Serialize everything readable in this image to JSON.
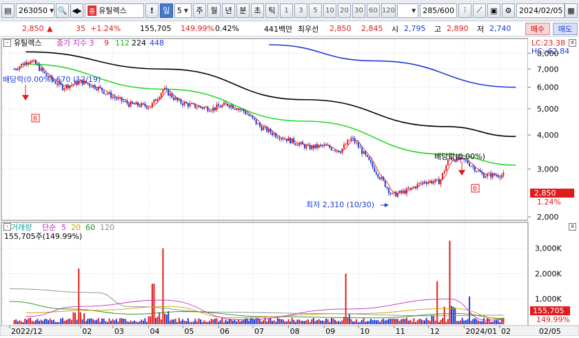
{
  "toolbar": {
    "code": "263050",
    "stock_name": "유틸렉스",
    "badge": "종",
    "period_selected": "일",
    "period_value": "5",
    "periods": [
      "주",
      "월",
      "년",
      "분",
      "초",
      "틱"
    ],
    "numbers": [
      "1",
      "3",
      "5",
      "10",
      "20",
      "30",
      "60",
      "120"
    ],
    "count": "285/600",
    "date": "2024/02/05",
    "alert": "!"
  },
  "quote": {
    "price": "2,850",
    "change": "35",
    "change_pct": "+1.24%",
    "volume": "155,705",
    "volume_ratio": "149.99%",
    "turnover": "0.42%",
    "amount": "441백만",
    "best_sell_label": "최우선",
    "best_sell": "2,850",
    "best_buy": "2,845",
    "open_label": "시",
    "open": "2,795",
    "high_label": "고",
    "high": "2,890",
    "low_label": "저",
    "low": "2,740",
    "buy_label": "매수",
    "sell_label": "매도"
  },
  "price_panel": {
    "title": "유틸렉스",
    "indicator_label": "종가 지수 3",
    "ma_values": [
      "9",
      "112",
      "224",
      "448"
    ],
    "lc_label": "LC:23.38",
    "hc_label": "HC:-62.84",
    "y_ticks": [
      "8,000",
      "7,000",
      "6,000",
      "5,000",
      "4,000",
      "3,000",
      "2,000"
    ],
    "current_price": "2,850",
    "current_pct": "1.24%",
    "high_annotation": "배당락(0.00%) 670 (12/19)",
    "dividend_annotation": "배당락(0.00%)",
    "low_annotation": "최저 2,310 (10/30)",
    "marker_b": "B"
  },
  "volume_panel": {
    "title": "거래량",
    "ma_label": "단순",
    "ma_values": [
      "5",
      "20",
      "60",
      "120"
    ],
    "volume_text": "155,705주(149.99%)",
    "y_ticks": [
      "3,000K",
      "2,000K",
      "1,000K"
    ],
    "current_volume": "155,705",
    "current_pct": "149.99%"
  },
  "x_axis": {
    "labels": [
      "2022/12",
      "02",
      "03",
      "04",
      "05",
      "06",
      "07",
      "08",
      "09",
      "10",
      "11",
      "12",
      "2024/01",
      "02",
      "02/05"
    ]
  },
  "colors": {
    "up": "#e11b1b",
    "down": "#1a3bd6",
    "ma9": "#e11b1b",
    "ma112": "#29d829",
    "ma224": "#000000",
    "ma448": "#1a3bd6"
  },
  "chart_data": {
    "type": "candlestick",
    "title": "유틸렉스",
    "x_range": [
      "2022/12",
      "2024/02/05"
    ],
    "y_range": [
      2000,
      8600
    ],
    "close_series": [
      [
        "2022/12/05",
        7000
      ],
      [
        "2022/12/19",
        7600
      ],
      [
        "2023/01/02",
        6600
      ],
      [
        "2023/01/16",
        6000
      ],
      [
        "2023/02/01",
        6300
      ],
      [
        "2023/02/15",
        6000
      ],
      [
        "2023/03/02",
        5500
      ],
      [
        "2023/03/15",
        5200
      ],
      [
        "2023/04/03",
        5100
      ],
      [
        "2023/04/14",
        5900
      ],
      [
        "2023/04/27",
        5300
      ],
      [
        "2023/05/12",
        5100
      ],
      [
        "2023/05/26",
        5000
      ],
      [
        "2023/06/09",
        5200
      ],
      [
        "2023/06/23",
        4900
      ],
      [
        "2023/07/07",
        4300
      ],
      [
        "2023/07/21",
        4000
      ],
      [
        "2023/08/04",
        3800
      ],
      [
        "2023/08/18",
        3600
      ],
      [
        "2023/09/01",
        3650
      ],
      [
        "2023/09/15",
        3500
      ],
      [
        "2023/09/25",
        3900
      ],
      [
        "2023/10/12",
        3100
      ],
      [
        "2023/10/30",
        2400
      ],
      [
        "2023/11/13",
        2500
      ],
      [
        "2023/11/27",
        2700
      ],
      [
        "2023/12/11",
        2700
      ],
      [
        "2023/12/19",
        3300
      ],
      [
        "2024/01/03",
        3200
      ],
      [
        "2024/01/17",
        2850
      ],
      [
        "2024/02/05",
        2850
      ]
    ],
    "moving_averages": [
      {
        "name": "9",
        "color": "#e11b1b"
      },
      {
        "name": "112",
        "color": "#29d829",
        "values": [
          [
            "2022/12",
            7300
          ],
          [
            "2023/04",
            5900
          ],
          [
            "2023/08",
            4500
          ],
          [
            "2023/12",
            3400
          ],
          [
            "2024/02",
            3100
          ]
        ]
      },
      {
        "name": "224",
        "color": "#000000",
        "values": [
          [
            "2022/12",
            8100
          ],
          [
            "2023/04",
            7000
          ],
          [
            "2023/08",
            5400
          ],
          [
            "2023/12",
            4300
          ],
          [
            "2024/02",
            3950
          ]
        ]
      },
      {
        "name": "448",
        "color": "#1a3bd6",
        "values": [
          [
            "2023/07",
            8600
          ],
          [
            "2023/10",
            7500
          ],
          [
            "2024/02",
            6000
          ]
        ]
      }
    ],
    "volume_peaks": [
      [
        "2023/01/30",
        2200
      ],
      [
        "2023/04/14",
        3000
      ],
      [
        "2023/04/05",
        1600
      ],
      [
        "2023/09/20",
        2000
      ],
      [
        "2023/12/08",
        1700
      ],
      [
        "2023/12/19",
        3300
      ],
      [
        "2024/01/05",
        1100
      ]
    ]
  }
}
